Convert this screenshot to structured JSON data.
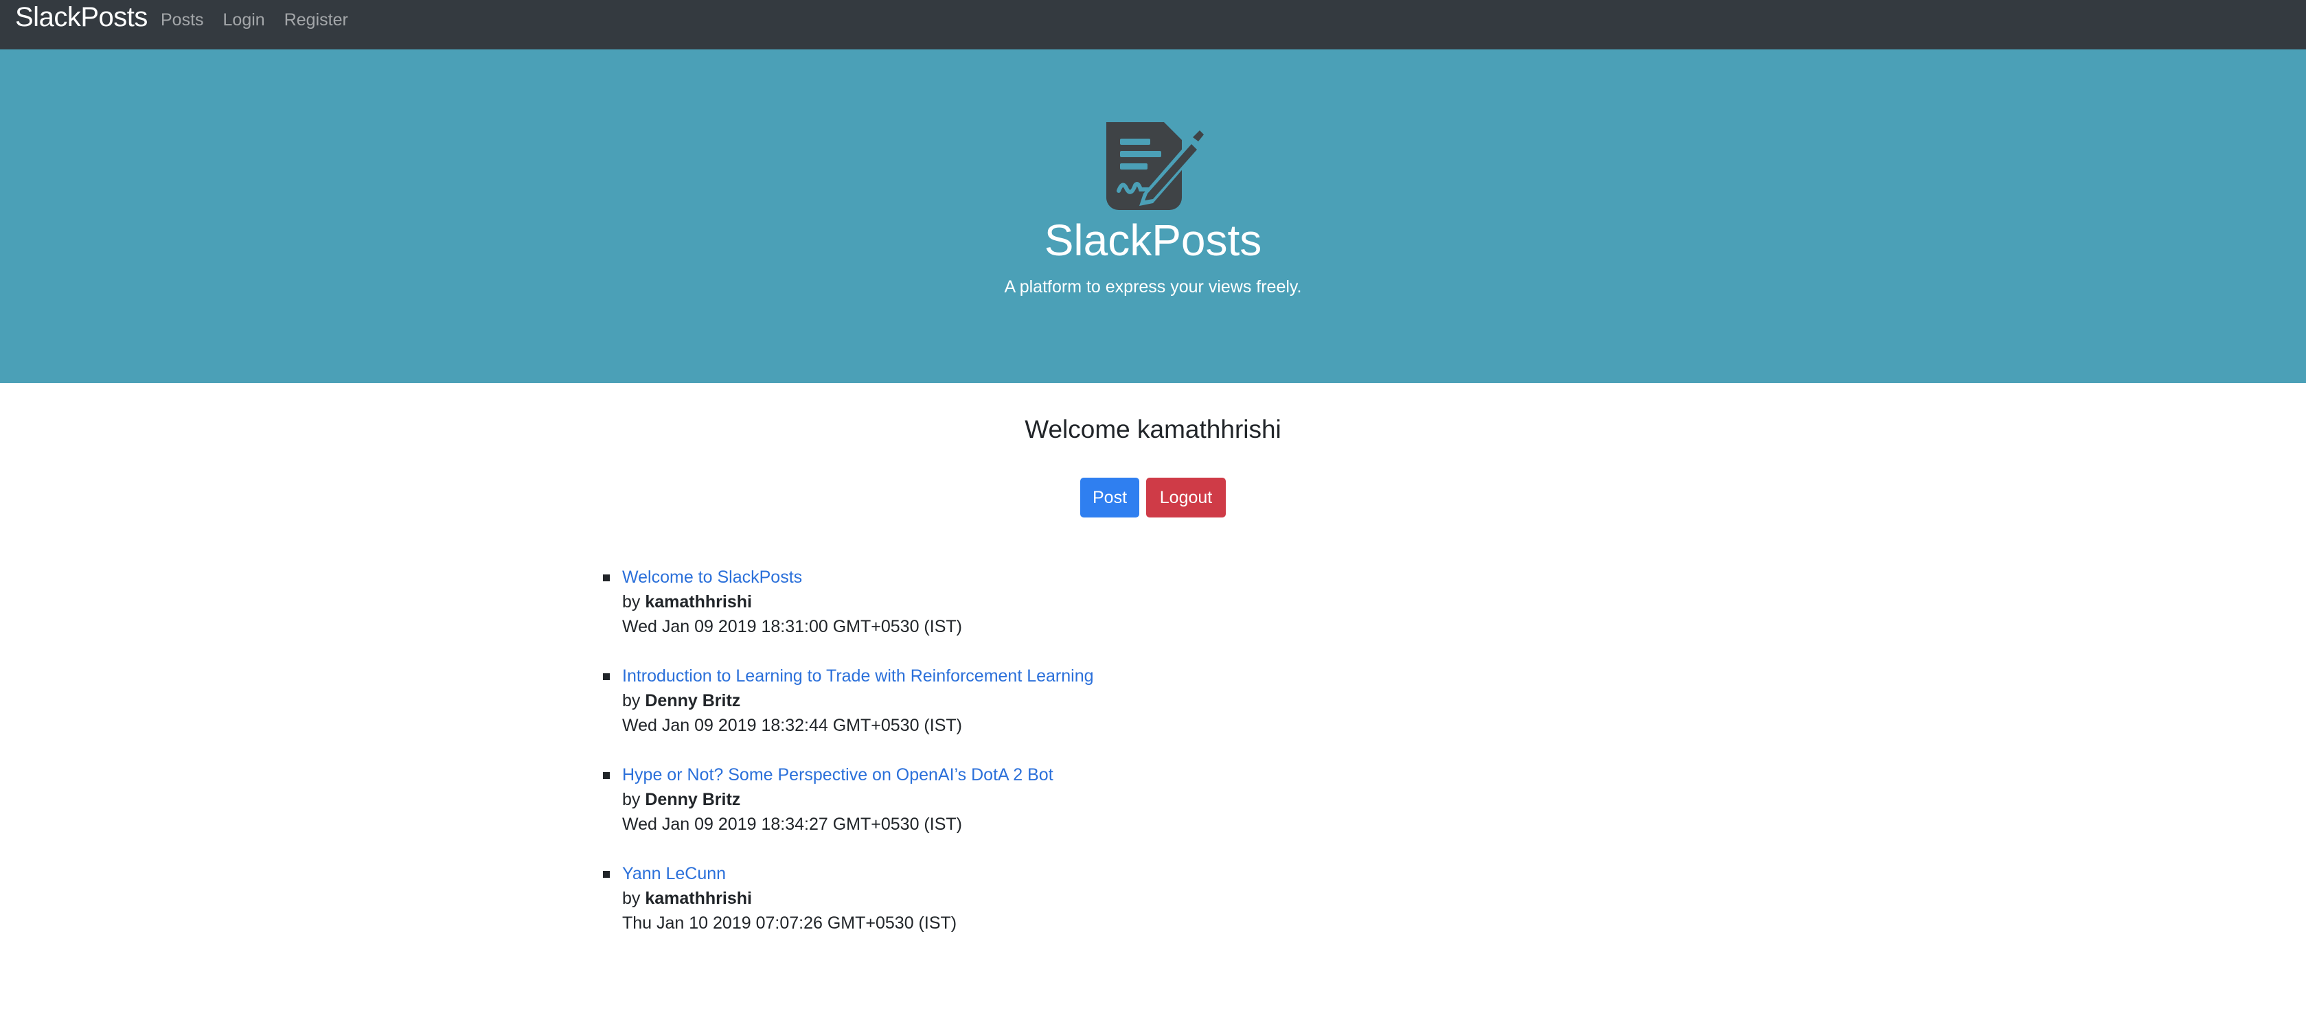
{
  "navbar": {
    "brand": "SlackPosts",
    "links": [
      "Posts",
      "Login",
      "Register"
    ]
  },
  "hero": {
    "icon": "file-signature-icon",
    "title": "SlackPosts",
    "subtitle": "A platform to express your views freely."
  },
  "main": {
    "welcome": "Welcome kamathhrishi",
    "post_button": "Post",
    "logout_button": "Logout",
    "by_label": "by",
    "posts": [
      {
        "title": "Welcome to SlackPosts",
        "author": "kamathhrishi",
        "date": "Wed Jan 09 2019 18:31:00 GMT+0530 (IST)"
      },
      {
        "title": "Introduction to Learning to Trade with Reinforcement Learning",
        "author": "Denny Britz",
        "date": "Wed Jan 09 2019 18:32:44 GMT+0530 (IST)"
      },
      {
        "title": "Hype or Not? Some Perspective on OpenAI’s DotA 2 Bot",
        "author": "Denny Britz",
        "date": "Wed Jan 09 2019 18:34:27 GMT+0530 (IST)"
      },
      {
        "title": "Yann LeCunn",
        "author": "kamathhrishi",
        "date": "Thu Jan 10 2019 07:07:26 GMT+0530 (IST)"
      }
    ]
  },
  "colors": {
    "navbar_bg": "#343a40",
    "hero_bg": "#4ba0b7",
    "primary": "#2f7ff0",
    "danger": "#cf3b47",
    "link": "#2b70da"
  }
}
